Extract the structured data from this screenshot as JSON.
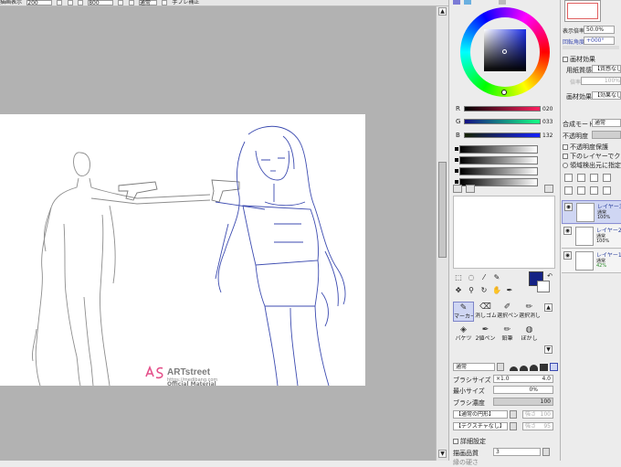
{
  "toolbar": {
    "display_label": "描画表示",
    "field1": "200",
    "field2": "800",
    "field3": "通常",
    "stabilizer_label": "手ブレ補正"
  },
  "watermark": {
    "brand": "ARTstreet",
    "url": "https://medibang.com",
    "subtitle": "Official Material"
  },
  "color": {
    "r_label": "R",
    "r_value": "020",
    "g_label": "G",
    "g_value": "033",
    "b_label": "B",
    "b_value": "132",
    "fg_color": "#142184"
  },
  "tools": {
    "row1": [
      "マーカー",
      "消しゴム",
      "選択ペン",
      "選択消し"
    ],
    "row2": [
      "バケツ",
      "2値ペン",
      "鉛筆",
      "ぼかし"
    ]
  },
  "brush": {
    "blend_mode": "通常",
    "size_label": "ブラシサイズ",
    "size_multiplier": "×1.0",
    "size_value": "4.0",
    "min_size_label": "最小サイズ",
    "min_size_value": "0%",
    "density_label": "ブラシ濃度",
    "density_value": "100",
    "shape_value": "【通常の円形】",
    "shape_strength": "強さ",
    "shape_strength_value": "100",
    "texture_value": "【テクスチャなし】",
    "texture_strength": "強さ",
    "texture_strength_value": "95",
    "advanced_label": "詳細設定",
    "quality_label": "描画品質",
    "quality_value": "3",
    "edge_label": "縁の硬さ"
  },
  "navigator": {
    "zoom_label": "表示倍率",
    "zoom_value": "50.0%",
    "rotation_label": "回転角度",
    "rotation_value": "+000°"
  },
  "layer_settings": {
    "effect_title": "画材効果",
    "paper_label": "用紙質感",
    "paper_value": "【質感なし】",
    "scale_label": "倍率",
    "scale_value": "100%",
    "material_label": "画材効果",
    "material_value": "【効果なし】",
    "blend_label": "合成モード",
    "blend_value": "通常",
    "opacity_label": "不透明度",
    "protect_label": "不透明度保護",
    "clip_label": "下のレイヤーでクリッピング",
    "source_label": "領域検出元に指定"
  },
  "layers": [
    {
      "name": "レイヤー3",
      "mode": "通常",
      "opacity": "100%"
    },
    {
      "name": "レイヤー2",
      "mode": "通常",
      "opacity": "100%"
    },
    {
      "name": "レイヤー1",
      "mode": "通常",
      "opacity": "42%"
    }
  ]
}
